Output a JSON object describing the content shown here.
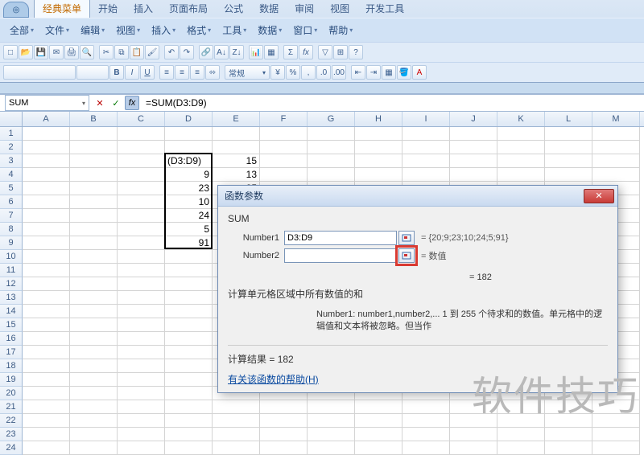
{
  "tabs": [
    "经典菜单",
    "开始",
    "插入",
    "页面布局",
    "公式",
    "数据",
    "审阅",
    "视图",
    "开发工具"
  ],
  "active_tab": 0,
  "menus": [
    "全部",
    "文件",
    "编辑",
    "视图",
    "插入",
    "格式",
    "工具",
    "数据",
    "窗口",
    "帮助"
  ],
  "toolbar2_style": "常规",
  "name_box": "SUM",
  "formula": "=SUM(D3:D9)",
  "columns": [
    "A",
    "B",
    "C",
    "D",
    "E",
    "F",
    "G",
    "H",
    "I",
    "J",
    "K",
    "L",
    "M"
  ],
  "row_count": 24,
  "selection": {
    "col": "D",
    "r1": 3,
    "r2": 9
  },
  "cells": {
    "D3": "(D3:D9)",
    "D4": "9",
    "D5": "23",
    "D6": "10",
    "D7": "24",
    "D8": "5",
    "D9": "91",
    "E3": "15",
    "E4": "13",
    "E5": "25"
  },
  "dialog": {
    "title": "函数参数",
    "fn": "SUM",
    "args": [
      {
        "label": "Number1",
        "value": "D3:D9",
        "eq": "{20;9;23;10;24;5;91}",
        "hl": false
      },
      {
        "label": "Number2",
        "value": "",
        "eq": "数值",
        "hl": true
      }
    ],
    "result_eq": "= 182",
    "desc": "计算单元格区域中所有数值的和",
    "arg_desc_label": "Number1:",
    "arg_desc": "number1,number2,... 1 到 255 个待求和的数值。单元格中的逻辑值和文本将被忽略。但当作",
    "calc_label": "计算结果 =",
    "calc_value": "182",
    "help": "有关该函数的帮助(H)"
  },
  "watermark": "软件技巧"
}
